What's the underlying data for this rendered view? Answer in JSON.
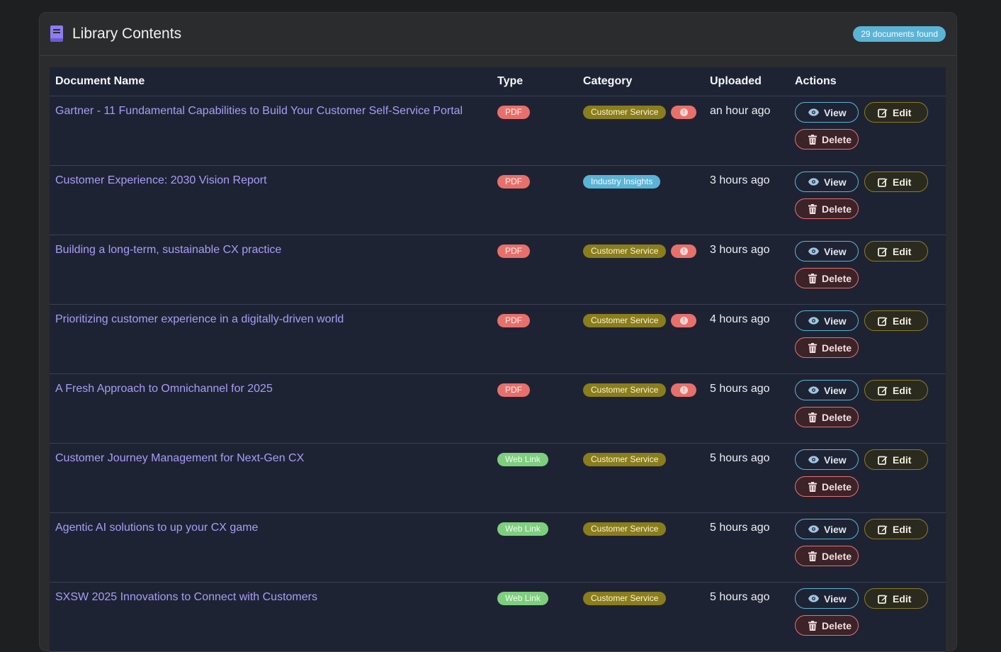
{
  "header": {
    "title": "Library Contents",
    "count_badge": "29 documents found"
  },
  "table": {
    "columns": [
      "Document Name",
      "Type",
      "Category",
      "Uploaded",
      "Actions"
    ],
    "actions": {
      "view": "View",
      "edit": "Edit",
      "delete": "Delete"
    },
    "rows": [
      {
        "name": "Gartner - 11 Fundamental Capabilities to Build Your Customer Self-Service Portal",
        "type": "PDF",
        "category": "Customer Service",
        "warning": true,
        "uploaded": "an hour ago"
      },
      {
        "name": "Customer Experience: 2030 Vision Report",
        "type": "PDF",
        "category": "Industry Insights",
        "warning": false,
        "uploaded": "3 hours ago"
      },
      {
        "name": "Building a long-term, sustainable CX practice",
        "type": "PDF",
        "category": "Customer Service",
        "warning": true,
        "uploaded": "3 hours ago"
      },
      {
        "name": "Prioritizing customer experience in a digitally-driven world",
        "type": "PDF",
        "category": "Customer Service",
        "warning": true,
        "uploaded": "4 hours ago"
      },
      {
        "name": "A Fresh Approach to Omnichannel for 2025",
        "type": "PDF",
        "category": "Customer Service",
        "warning": true,
        "uploaded": "5 hours ago"
      },
      {
        "name": "Customer Journey Management for Next-Gen CX",
        "type": "Web Link",
        "category": "Customer Service",
        "warning": false,
        "uploaded": "5 hours ago"
      },
      {
        "name": "Agentic AI solutions to up your CX game",
        "type": "Web Link",
        "category": "Customer Service",
        "warning": false,
        "uploaded": "5 hours ago"
      },
      {
        "name": "SXSW 2025 Innovations to Connect with Customers",
        "type": "Web Link",
        "category": "Customer Service",
        "warning": false,
        "uploaded": "5 hours ago"
      }
    ]
  },
  "colors": {
    "accent": "#a99cf5",
    "pdf": "#e8706b",
    "web_link": "#7dcf7d",
    "customer_service": "#8a7d1c",
    "industry_insights": "#5ab4d6"
  },
  "icons": {
    "header": "book-icon",
    "warning": "exclamation-circle-icon",
    "view": "eye-icon",
    "edit": "edit-icon",
    "delete": "trash-icon"
  }
}
